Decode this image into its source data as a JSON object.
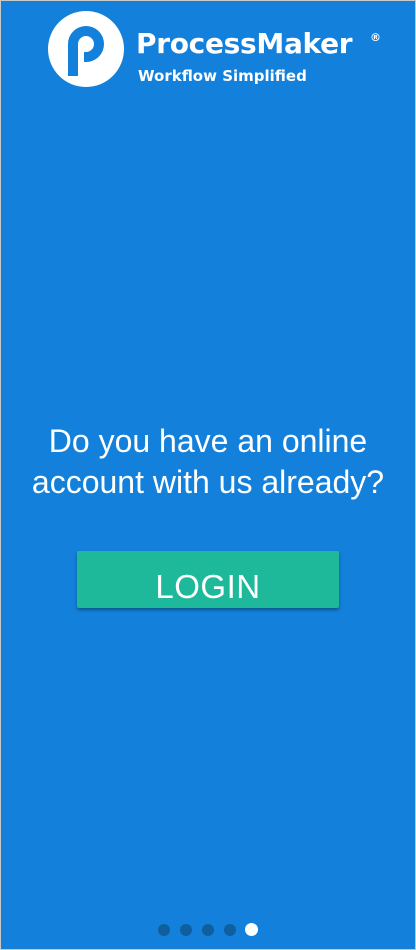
{
  "brand": {
    "name": "ProcessMaker",
    "registered_mark": "®",
    "tagline": "Workflow Simplified"
  },
  "onboarding": {
    "question_line1": "Do you have an online",
    "question_line2": "account with us already?",
    "login_label": "LOGIN"
  },
  "pager": {
    "total_pages": 5,
    "current_page": 5
  },
  "colors": {
    "background": "#1381DB",
    "login_button": "#1DB99A",
    "dot_inactive": "#0F5F9E",
    "dot_active": "#FFFFFF",
    "text": "#FFFFFF"
  }
}
